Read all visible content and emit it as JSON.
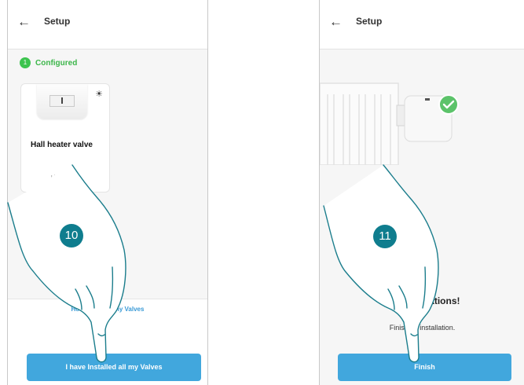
{
  "colors": {
    "accent": "#41a7dd",
    "success": "#3cc44e",
    "step_badge": "#0f7d8e"
  },
  "left_screen": {
    "header": {
      "back_icon": "arrow-left-icon",
      "title": "Setup"
    },
    "configured": {
      "count": "1",
      "label": "Configured"
    },
    "device_card": {
      "name": "Hall heater valve",
      "room": "Living room",
      "icon": "light-bulb-icon"
    },
    "how_to_link": "How to install my Valves",
    "primary_button": "I have Installed all my Valves"
  },
  "right_screen": {
    "header": {
      "back_icon": "arrow-left-icon",
      "title": "Setup"
    },
    "success_title": "Congratulations!",
    "success_subtitle": "Finishing installation.",
    "primary_button": "Finish"
  },
  "steps": {
    "left": "10",
    "right": "11"
  }
}
